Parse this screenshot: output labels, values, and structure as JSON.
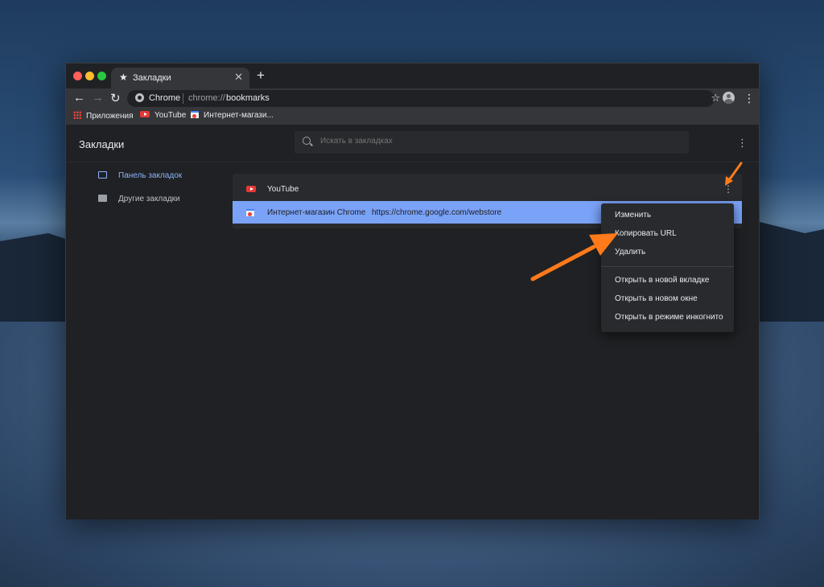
{
  "window": {
    "tab_title": "Закладки",
    "new_tab_label": "+"
  },
  "toolbar": {
    "omnibox_chip": "Chrome",
    "url_scheme": "chrome://",
    "url_host": "bookmarks"
  },
  "bookmarks_bar": {
    "items": [
      {
        "label": "Приложения",
        "icon": "apps-grid-icon"
      },
      {
        "label": "YouTube",
        "icon": "youtube-icon"
      },
      {
        "label": "Интернет-магази...",
        "icon": "webstore-icon"
      }
    ]
  },
  "page": {
    "title": "Закладки",
    "search_placeholder": "Искать в закладках"
  },
  "sidebar": {
    "items": [
      {
        "label": "Панель закладок",
        "active": true
      },
      {
        "label": "Другие закладки",
        "active": false
      }
    ]
  },
  "bookmarks": [
    {
      "title": "YouTube",
      "url": ""
    },
    {
      "title": "Интернет-магазин Chrome",
      "url": "https://chrome.google.com/webstore"
    }
  ],
  "context_menu": {
    "items": [
      "Изменить",
      "Копировать URL",
      "Удалить",
      "Открыть в новой вкладке",
      "Открыть в новом окне",
      "Открыть в режиме инкогнито"
    ]
  },
  "colors": {
    "accent": "#8ab4f8",
    "selected_row": "#7aa2f7",
    "annotation_arrow": "#ff7a1a"
  }
}
